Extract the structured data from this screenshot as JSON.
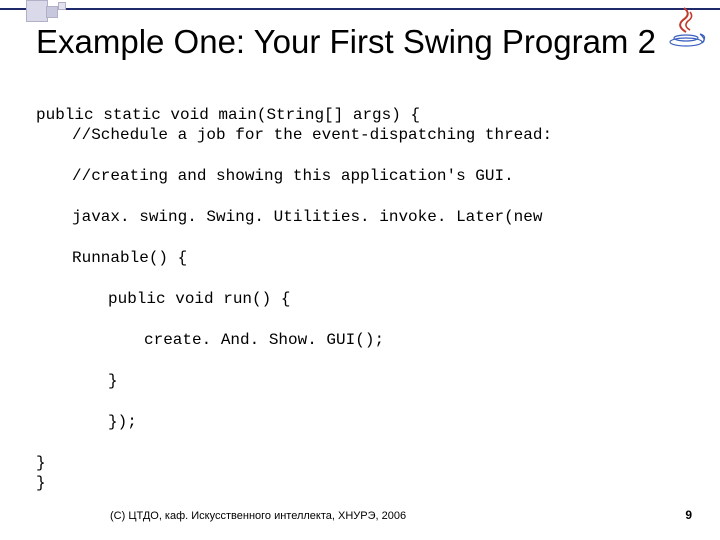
{
  "title": "Example One: Your First Swing Program 2",
  "code": {
    "l0": "public static void main(String[] args) {",
    "l1": "//Schedule a job for the event-dispatching thread:",
    "l2": "//creating and showing this application's GUI.",
    "l3": "javax. swing. Swing. Utilities. invoke. Later(new",
    "l4": "Runnable() {",
    "l5": "public void run() {",
    "l6": "create. And. Show. GUI();",
    "l7": "}",
    "l8": "});",
    "l9": "}",
    "l10": "}"
  },
  "footer": {
    "credit": "(С) ЦТДО, каф. Искусственного интеллекта, ХНУРЭ, 2006",
    "page": "9"
  },
  "icons": {
    "java_logo": "java-logo-icon"
  }
}
